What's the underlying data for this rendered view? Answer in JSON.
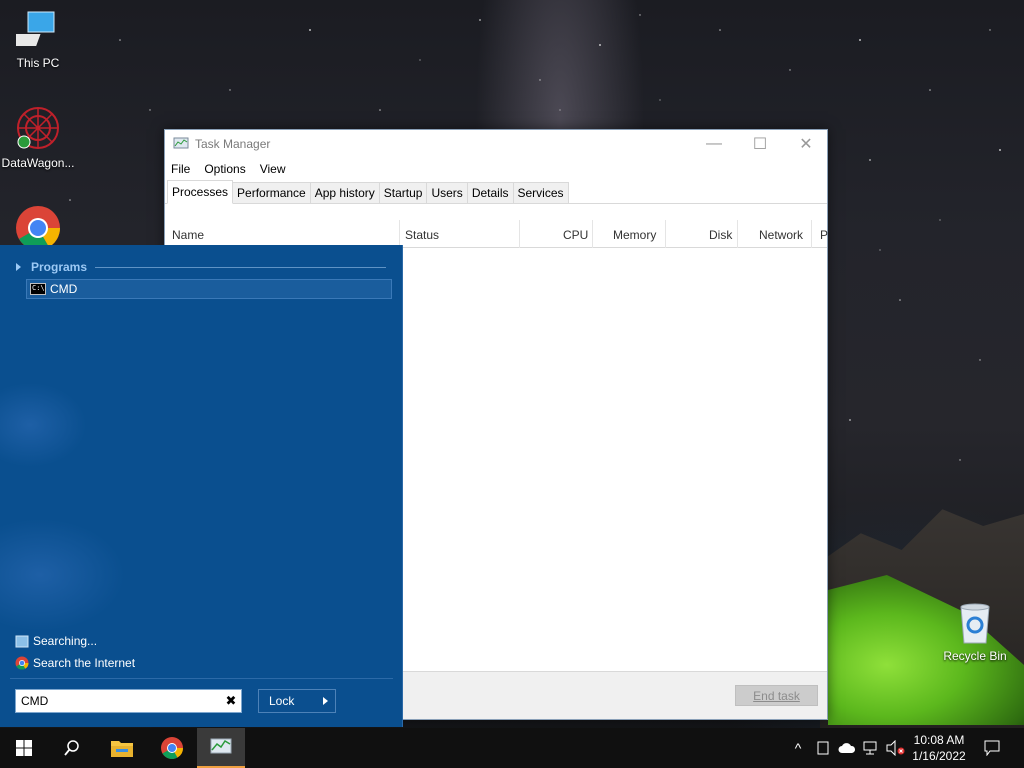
{
  "desktop": {
    "icons": [
      {
        "label": "This PC"
      },
      {
        "label": "DataWagon..."
      },
      {
        "label": "Google Chrome"
      },
      {
        "label": "Recycle Bin"
      }
    ]
  },
  "task_manager": {
    "title": "Task Manager",
    "menu": [
      "File",
      "Options",
      "View"
    ],
    "tabs": [
      "Processes",
      "Performance",
      "App history",
      "Startup",
      "Users",
      "Details",
      "Services"
    ],
    "active_tab": "Processes",
    "columns": [
      "Name",
      "Status",
      "CPU",
      "Memory",
      "Disk",
      "Network",
      "P"
    ],
    "end_task_label": "End task",
    "window_buttons": {
      "minimize": "—",
      "maximize": "☐",
      "close": "✕"
    }
  },
  "start_menu": {
    "programs_heading": "Programs",
    "results": [
      {
        "label": "CMD",
        "icon": "cmd-icon"
      }
    ],
    "searching_label": "Searching...",
    "search_internet_label": "Search the Internet",
    "search_value": "CMD",
    "clear_glyph": "✖",
    "lock_label": "Lock"
  },
  "taskbar": {
    "clock_time": "10:08 AM",
    "clock_date": "1/16/2022",
    "tray_chevron": "^",
    "accent_color": "#f0a040"
  },
  "colors": {
    "start_menu_bg": "#0a4f8f",
    "selection": "#1a5d9d"
  }
}
